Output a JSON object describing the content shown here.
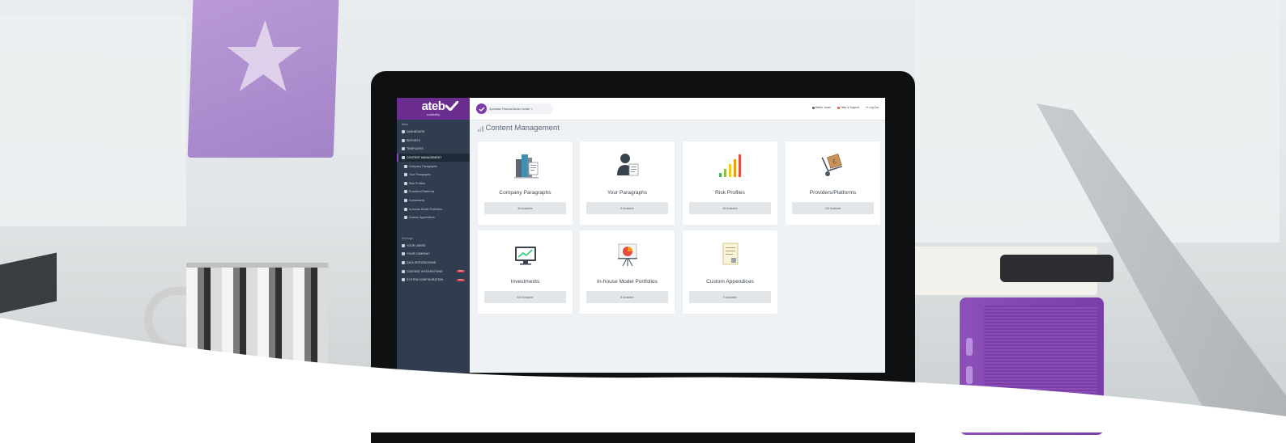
{
  "app": {
    "brand_name": "ateb",
    "brand_tagline": "suitability"
  },
  "topbar": {
    "organisation": "Sprowston Financial Advice Limited",
    "user_name": "Martin Jones",
    "help_label": "Help & Support",
    "logout_label": "Log Out"
  },
  "sidebar": {
    "section_main": "Main",
    "items": [
      {
        "label": "DASHBOARD"
      },
      {
        "label": "REPORTS"
      },
      {
        "label": "TEMPLATES"
      },
      {
        "label": "CONTENT MANAGEMENT"
      },
      {
        "label": "Company Paragraphs"
      },
      {
        "label": "Your Paragraphs"
      },
      {
        "label": "Risk Profiles"
      },
      {
        "label": "Providers/Platforms"
      },
      {
        "label": "Investments"
      },
      {
        "label": "In-house Model Portfolios"
      },
      {
        "label": "Custom Appendices"
      }
    ],
    "section_settings": "Settings",
    "settings_items": [
      {
        "label": "YOUR USERS"
      },
      {
        "label": "YOUR COMPANY"
      },
      {
        "label": "DATA INTEGRATIONS"
      },
      {
        "label": "CONTENT INTEGRATIONS",
        "badge": "NEW"
      },
      {
        "label": "SYSTEM CONFIGURATION",
        "badge": "NEW"
      }
    ]
  },
  "main": {
    "title": "Content Management",
    "cards": [
      {
        "label": "Company Paragraphs",
        "count": "36 Available",
        "icon": "buildings-document-icon"
      },
      {
        "label": "Your Paragraphs",
        "count": "8 Available",
        "icon": "user-document-icon"
      },
      {
        "label": "Risk Profiles",
        "count": "45 Available",
        "icon": "signal-bars-icon"
      },
      {
        "label": "Providers/Platforms",
        "count": "115 Available",
        "icon": "handtruck-box-icon"
      },
      {
        "label": "Investments",
        "count": "534 Available",
        "icon": "monitor-chart-icon"
      },
      {
        "label": "In-house Model Portfolios",
        "count": "8 Available",
        "icon": "easel-pie-icon"
      },
      {
        "label": "Custom Appendices",
        "count": "5 Available",
        "icon": "notepad-icon"
      }
    ]
  },
  "colors": {
    "brand_purple": "#6c2d91",
    "sidebar_bg": "#2f3d4f",
    "content_bg": "#eef2f5",
    "badge_red": "#d9323a"
  }
}
